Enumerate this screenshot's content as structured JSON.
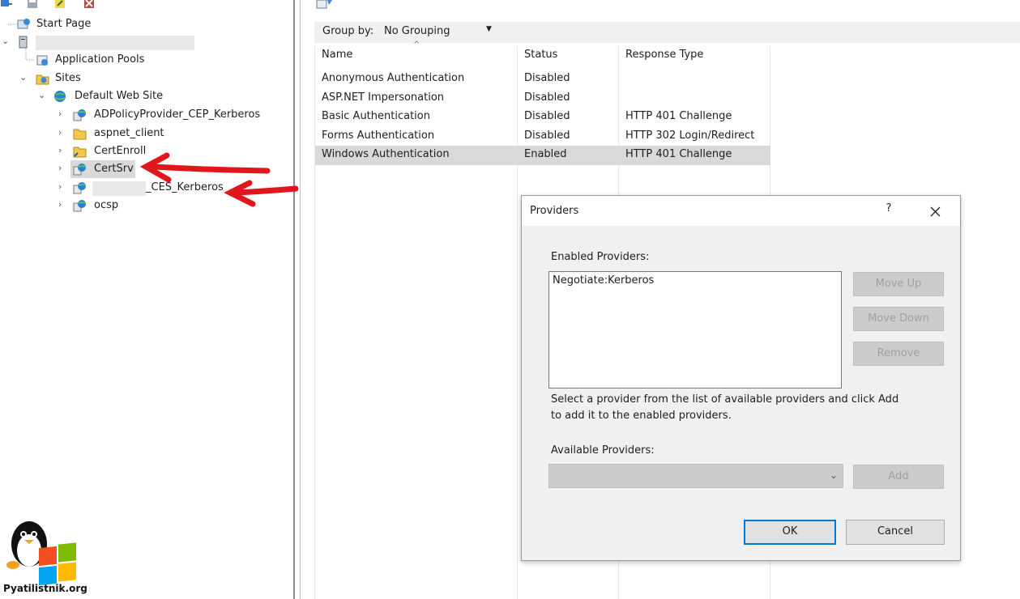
{
  "toolbar": {
    "icons": [
      "connect-icon",
      "save-icon",
      "edit-icon",
      "delete-icon"
    ]
  },
  "tree": {
    "start_page": "Start Page",
    "server_name": "",
    "application_pools": "Application Pools",
    "sites": "Sites",
    "default_web_site": "Default Web Site",
    "children": [
      {
        "label": "ADPolicyProvider_CEP_Kerberos",
        "icon": "web-app-icon"
      },
      {
        "label": "aspnet_client",
        "icon": "folder-icon"
      },
      {
        "label": "CertEnroll",
        "icon": "virtual-directory-icon"
      },
      {
        "label": "CertSrv",
        "icon": "web-app-icon"
      },
      {
        "label": "_CES_Kerberos",
        "icon": "web-app-icon"
      },
      {
        "label": "ocsp",
        "icon": "web-app-icon"
      }
    ]
  },
  "list": {
    "group_by_label": "Group by:",
    "group_by_value": "No Grouping",
    "columns": [
      "Name",
      "Status",
      "Response Type"
    ],
    "rows": [
      {
        "name": "Anonymous Authentication",
        "status": "Disabled",
        "response": ""
      },
      {
        "name": "ASP.NET Impersonation",
        "status": "Disabled",
        "response": ""
      },
      {
        "name": "Basic Authentication",
        "status": "Disabled",
        "response": "HTTP 401 Challenge"
      },
      {
        "name": "Forms Authentication",
        "status": "Disabled",
        "response": "HTTP 302 Login/Redirect"
      },
      {
        "name": "Windows Authentication",
        "status": "Enabled",
        "response": "HTTP 401 Challenge"
      }
    ],
    "selected_row": 4
  },
  "dialog": {
    "title": "Providers",
    "help": "?",
    "enabled_label": "Enabled Providers:",
    "enabled_items": [
      "Negotiate:Kerberos"
    ],
    "move_up": "Move Up",
    "move_down": "Move Down",
    "remove": "Remove",
    "hint_line1": "Select a provider from the list of available providers and click Add",
    "hint_line2": "to add it to the enabled providers.",
    "available_label": "Available Providers:",
    "available_value": "",
    "add": "Add",
    "ok": "OK",
    "cancel": "Cancel"
  },
  "watermark": {
    "site": "Pyatilistnik.org"
  },
  "colors": {
    "selection": "#d9d9d9",
    "accent": "#0078d7",
    "annotation_arrow": "#e0161b"
  }
}
